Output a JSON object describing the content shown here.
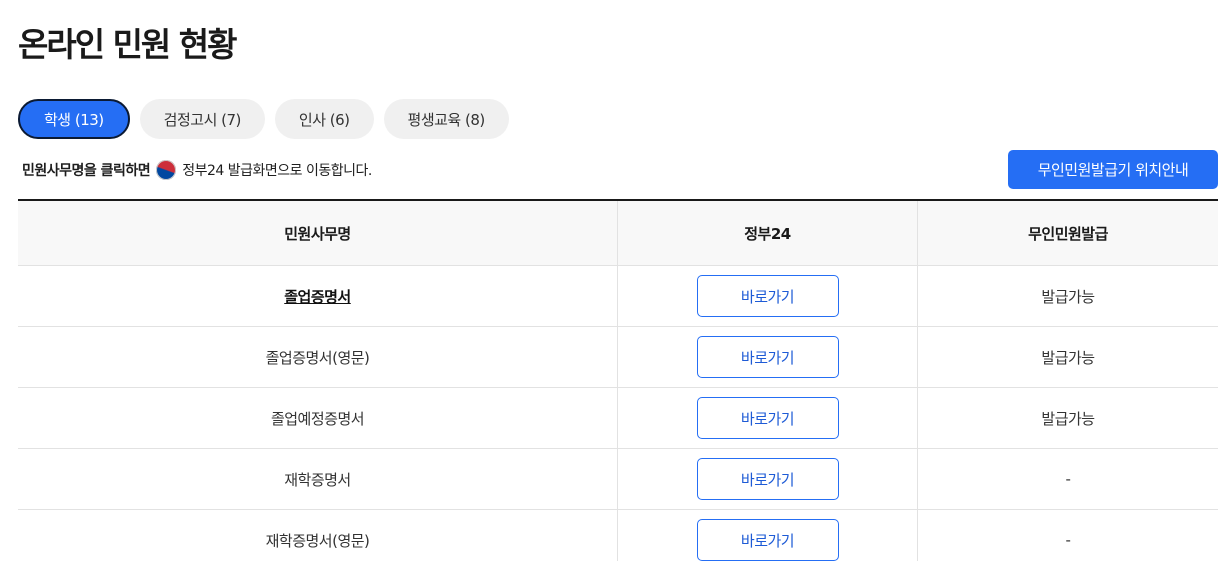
{
  "page_title": "온라인 민원 현황",
  "tabs": [
    {
      "label": "학생 (13)",
      "active": true
    },
    {
      "label": "검정고시 (7)",
      "active": false
    },
    {
      "label": "인사 (6)",
      "active": false
    },
    {
      "label": "평생교육 (8)",
      "active": false
    }
  ],
  "notice": {
    "strong_text": "민원사무명을 클릭하면",
    "icon": "korea-gov-emblem-icon",
    "rest_text": "정부24 발급화면으로 이동합니다."
  },
  "kiosk_button_label": "무인민원발급기 위치안내",
  "table": {
    "headers": [
      "민원사무명",
      "정부24",
      "무인민원발급"
    ],
    "rows": [
      {
        "name": "졸업증명서",
        "button": "바로가기",
        "kiosk": "발급가능"
      },
      {
        "name": "졸업증명서(영문)",
        "button": "바로가기",
        "kiosk": "발급가능"
      },
      {
        "name": "졸업예정증명서",
        "button": "바로가기",
        "kiosk": "발급가능"
      },
      {
        "name": "재학증명서",
        "button": "바로가기",
        "kiosk": "-"
      },
      {
        "name": "재학증명서(영문)",
        "button": "바로가기",
        "kiosk": "-"
      }
    ]
  },
  "colors": {
    "accent": "#256ef4",
    "active_tab_border": "#0b1a33",
    "tab_bg": "#f0f0f0"
  }
}
